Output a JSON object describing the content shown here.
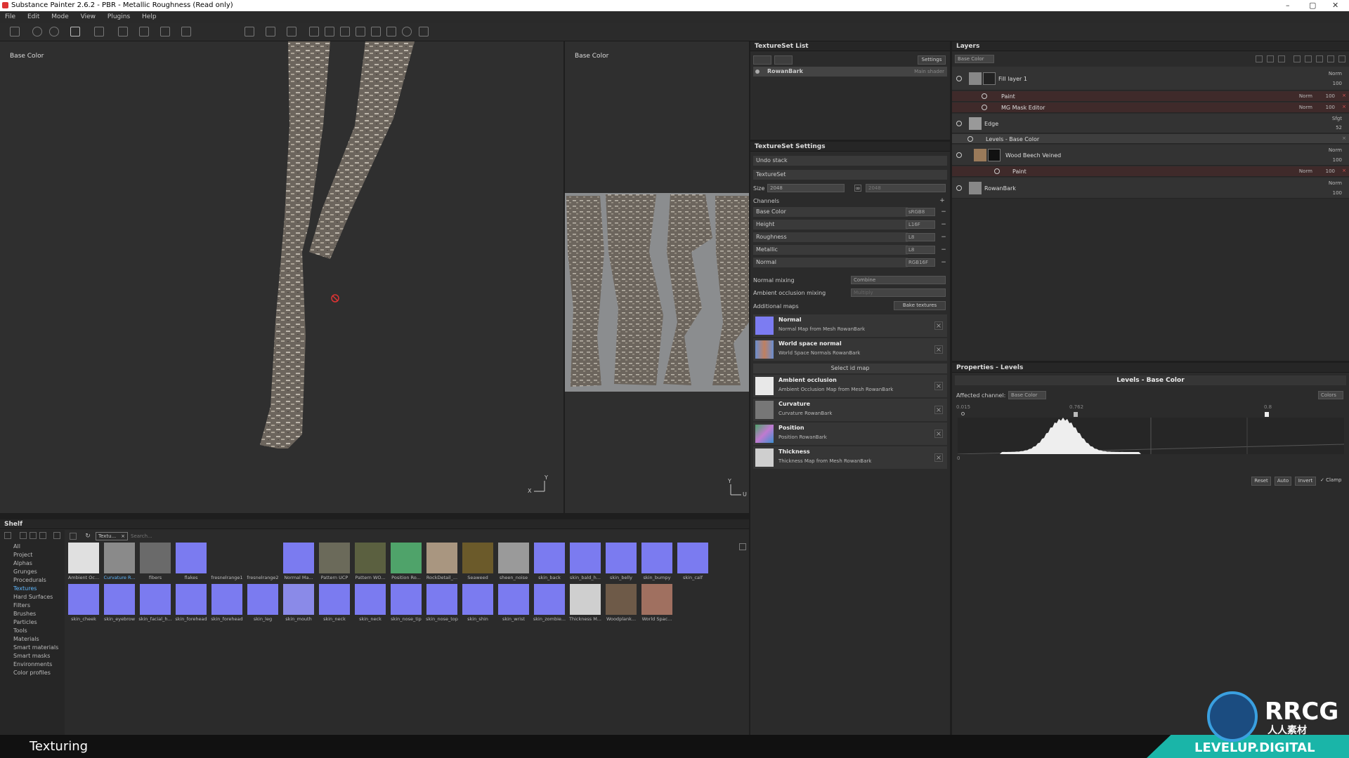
{
  "window": {
    "title": "Substance Painter 2.6.2 - PBR - Metallic Roughness (Read only)",
    "controls": [
      "–",
      "▢",
      "✕"
    ]
  },
  "menu": [
    "File",
    "Edit",
    "Mode",
    "View",
    "Plugins",
    "Help"
  ],
  "viewport3d": {
    "label": "Base Color",
    "axis_y": "Y",
    "axis_x": "X"
  },
  "viewport2d": {
    "label": "Base Color",
    "axis_y": "Y",
    "axis_x": "U"
  },
  "texture_set_list": {
    "title": "TextureSet List",
    "settings_btn": "Settings",
    "item": "RowanBark",
    "shader": "Main shader"
  },
  "texture_set_settings": {
    "title": "TextureSet Settings",
    "undo_stack": "Undo stack",
    "texture_set": "TextureSet",
    "size_label": "Size",
    "size_value": "2048",
    "size_value2": "2048",
    "channels_label": "Channels",
    "channels": [
      {
        "name": "Base Color",
        "format": "sRGB8"
      },
      {
        "name": "Height",
        "format": "L16F"
      },
      {
        "name": "Roughness",
        "format": "L8"
      },
      {
        "name": "Metallic",
        "format": "L8"
      },
      {
        "name": "Normal",
        "format": "RGB16F"
      }
    ],
    "normal_mixing_label": "Normal mixing",
    "normal_mixing_value": "Combine",
    "ao_mixing_label": "Ambient occlusion mixing",
    "ao_mixing_value": "Multiply",
    "additional_maps_label": "Additional maps",
    "bake_btn": "Bake textures",
    "select_id_map": "Select id map",
    "maps": [
      {
        "title": "Normal",
        "sub": "Normal Map from Mesh RowanBark",
        "color": "#7c7cf2"
      },
      {
        "title": "World space normal",
        "sub": "World Space Normals RowanBark",
        "color": "#9a6a50"
      },
      {
        "title": "Ambient occlusion",
        "sub": "Ambient Occlusion Map from Mesh RowanBark",
        "color": "#e8e8e8"
      },
      {
        "title": "Curvature",
        "sub": "Curvature RowanBark",
        "color": "#777777"
      },
      {
        "title": "Position",
        "sub": "Position RowanBark",
        "color": "#5fae6a"
      },
      {
        "title": "Thickness",
        "sub": "Thickness Map from Mesh RowanBark",
        "color": "#cfcfcf"
      }
    ]
  },
  "layers": {
    "title": "Layers",
    "channel": "Base Color",
    "items": [
      {
        "name": "Fill layer 1",
        "blend": "Norm",
        "opacity": "100"
      },
      {
        "name": "Paint",
        "blend": "Norm",
        "opacity": "100"
      },
      {
        "name": "MG Mask Editor",
        "blend": "Norm",
        "opacity": "100"
      },
      {
        "name": "Edge",
        "blend": "Sfgt",
        "opacity": "52"
      },
      {
        "name": "Levels - Base Color"
      },
      {
        "name": "Wood Beech Veined",
        "blend": "Norm",
        "opacity": "100"
      },
      {
        "name": "Paint",
        "blend": "Norm",
        "opacity": "100"
      },
      {
        "name": "RowanBark",
        "blend": "Norm",
        "opacity": "100"
      }
    ]
  },
  "properties": {
    "title": "Properties - Levels",
    "section": "Levels - Base Color",
    "affected_label": "Affected channel:",
    "affected_value": "Base Color",
    "mode_value": "Colors",
    "marker_low": "0.015",
    "marker_mid": "0.762",
    "marker_high": "0.8",
    "out_low": "0",
    "buttons": [
      "Reset",
      "Auto",
      "Invert"
    ],
    "clamp": "Clamp"
  },
  "shelf": {
    "title": "Shelf",
    "filter_tag": "Textu...",
    "search_placeholder": "Search...",
    "categories": [
      "All",
      "Project",
      "Alphas",
      "Grunges",
      "Procedurals",
      "Textures",
      "Hard Surfaces",
      "Filters",
      "Brushes",
      "Particles",
      "Tools",
      "Materials",
      "Smart materials",
      "Smart masks",
      "Environments",
      "Color profiles"
    ],
    "selected_category": "Textures",
    "row1": [
      {
        "label": "Ambient Oc...",
        "color": "#e0e0e0"
      },
      {
        "label": "Curvature R...",
        "color": "#8a8a8a"
      },
      {
        "label": "fibers",
        "color": "#6a6a6a"
      },
      {
        "label": "flakes",
        "color": "#7b7bf0"
      },
      {
        "label": "fresnelrange1",
        "color": "#2b2b2b"
      },
      {
        "label": "fresnelrange2",
        "color": "#2b2b2b"
      },
      {
        "label": "Normal Ma...",
        "color": "#7b7bf0"
      },
      {
        "label": "Pattern UCP",
        "color": "#6b6a5a"
      },
      {
        "label": "Pattern WO...",
        "color": "#5b6040"
      },
      {
        "label": "Position Ro...",
        "color": "#4fa36a"
      },
      {
        "label": "RockDetail_...",
        "color": "#a99680"
      },
      {
        "label": "Seaweed",
        "color": "#6b5a2a"
      },
      {
        "label": "sheen_noise",
        "color": "#9a9a9a"
      },
      {
        "label": "skin_back",
        "color": "#7b7bf0"
      },
      {
        "label": "skin_bald_h...",
        "color": "#7b7bf0"
      },
      {
        "label": "skin_belly",
        "color": "#7b7bf0"
      },
      {
        "label": "skin_bumpy",
        "color": "#7b7bf0"
      },
      {
        "label": "skin_calf",
        "color": "#7b7bf0"
      }
    ],
    "row2": [
      {
        "label": "skin_cheek",
        "color": "#7b7bf0"
      },
      {
        "label": "skin_eyebrow",
        "color": "#7b7bf0"
      },
      {
        "label": "skin_facial_h...",
        "color": "#7b7bf0"
      },
      {
        "label": "skin_forehead",
        "color": "#7b7bf0"
      },
      {
        "label": "skin_forehead",
        "color": "#7b7bf0"
      },
      {
        "label": "skin_leg",
        "color": "#7b7bf0"
      },
      {
        "label": "skin_mouth",
        "color": "#8a8ae8"
      },
      {
        "label": "skin_neck",
        "color": "#7b7bf0"
      },
      {
        "label": "skin_neck",
        "color": "#7b7bf0"
      },
      {
        "label": "skin_nose_tip",
        "color": "#7b7bf0"
      },
      {
        "label": "skin_nose_top",
        "color": "#7b7bf0"
      },
      {
        "label": "skin_shin",
        "color": "#7b7bf0"
      },
      {
        "label": "skin_wrist",
        "color": "#7b7bf0"
      },
      {
        "label": "skin_zombie...",
        "color": "#7b7bf0"
      },
      {
        "label": "Thickness M...",
        "color": "#cfcfcf"
      },
      {
        "label": "Woodplank...",
        "color": "#6e5a48"
      },
      {
        "label": "World Spac...",
        "color": "#a07060"
      }
    ]
  },
  "caption": "Texturing",
  "watermark": {
    "top": "RRCG",
    "cn": "人人素材",
    "bottom": "LEVELUP.DIGITAL"
  }
}
